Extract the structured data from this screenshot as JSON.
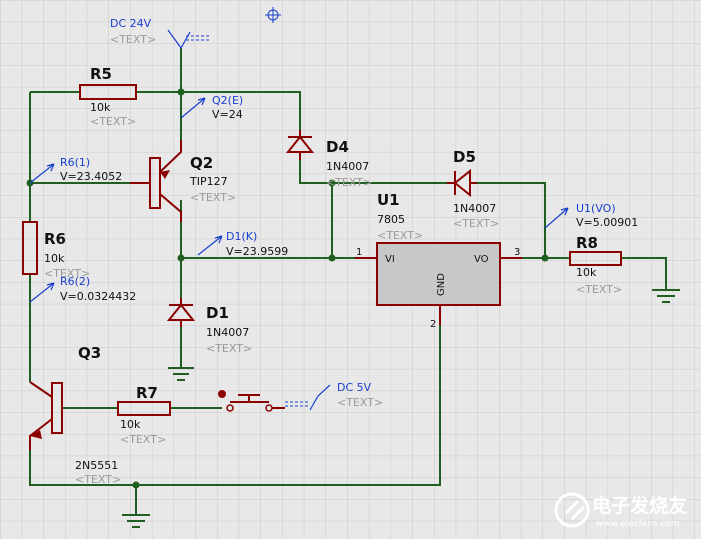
{
  "labels": {
    "dc24": "DC 24V",
    "dc5": "DC 5V",
    "text": "<TEXT>",
    "r5": "R5",
    "r5v": "10k",
    "r6": "R6",
    "r6v": "10k",
    "r7": "R7",
    "r7v": "10k",
    "r8": "R8",
    "r8v": "10k",
    "q2": "Q2",
    "q2v": "TIP127",
    "q3": "Q3",
    "q3v": "2N5551",
    "d1": "D1",
    "d1v": "1N4007",
    "d4": "D4",
    "d4v": "1N4007",
    "d5": "D5",
    "d5v": "1N4007",
    "u1": "U1",
    "u1v": "7805",
    "vi": "VI",
    "vo": "VO",
    "gnd": "GND",
    "pin1": "1",
    "pin2": "2",
    "pin3": "3"
  },
  "probes": {
    "q2e_name": "Q2(E)",
    "q2e_val": "V=24",
    "r61_name": "R6(1)",
    "r61_val": "V=23.4052",
    "d1k_name": "D1(K)",
    "d1k_val": "V=23.9599",
    "r62_name": "R6(2)",
    "r62_val": "V=0.0324432",
    "u1vo_name": "U1(VO)",
    "u1vo_val": "V=5.00901"
  },
  "watermark": {
    "main": "电子发烧友",
    "sub": "www.elecfans.com"
  },
  "colors": {
    "wire": "#1f5f1f",
    "component": "#8b0000",
    "probe": "#1a3fd0",
    "ic": "#c8c8c8"
  }
}
